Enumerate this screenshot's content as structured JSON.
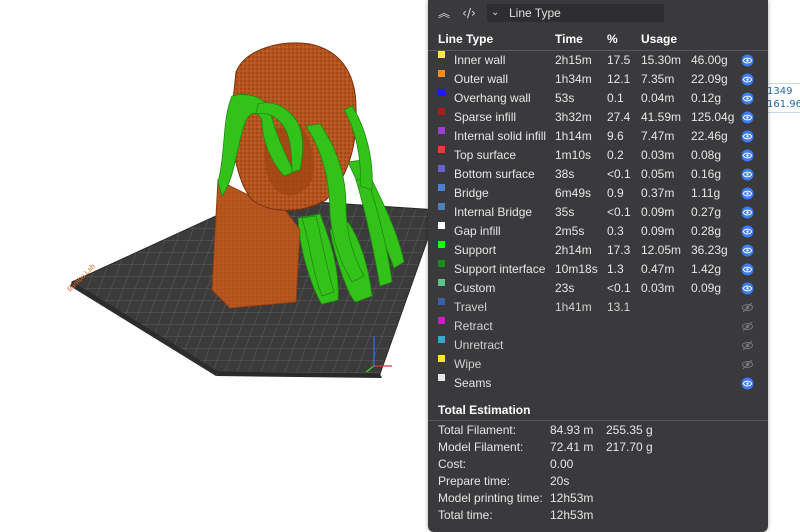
{
  "viewport": {
    "plate_label": "Bambu Lab",
    "coord_readout": [
      "1349",
      "161.96"
    ]
  },
  "toolbar": {
    "collapse_icon": "double-chevron-up-icon",
    "code_icon": "code-brackets-icon",
    "view_select": "Line Type"
  },
  "table": {
    "headers": {
      "line_type": "Line Type",
      "time": "Time",
      "percent": "%",
      "usage": "Usage"
    },
    "rows": [
      {
        "name": "Inner wall",
        "color": "#ffe64d",
        "time": "2h15m",
        "percent": "17.5",
        "length": "15.30m",
        "weight": "46.00g",
        "visible": true
      },
      {
        "name": "Outer wall",
        "color": "#ff8c1a",
        "time": "1h34m",
        "percent": "12.1",
        "length": "7.35m",
        "weight": "22.09g",
        "visible": true
      },
      {
        "name": "Overhang wall",
        "color": "#1a1aff",
        "time": "53s",
        "percent": "0.1",
        "length": "0.04m",
        "weight": "0.12g",
        "visible": true
      },
      {
        "name": "Sparse infill",
        "color": "#b01a1a",
        "time": "3h32m",
        "percent": "27.4",
        "length": "41.59m",
        "weight": "125.04g",
        "visible": true
      },
      {
        "name": "Internal solid infill",
        "color": "#9a3fd6",
        "time": "1h14m",
        "percent": "9.6",
        "length": "7.47m",
        "weight": "22.46g",
        "visible": true
      },
      {
        "name": "Top surface",
        "color": "#e63c3c",
        "time": "1m10s",
        "percent": "0.2",
        "length": "0.03m",
        "weight": "0.08g",
        "visible": true
      },
      {
        "name": "Bottom surface",
        "color": "#6b5fd6",
        "time": "38s",
        "percent": "<0.1",
        "length": "0.05m",
        "weight": "0.16g",
        "visible": true
      },
      {
        "name": "Bridge",
        "color": "#4a7fd6",
        "time": "6m49s",
        "percent": "0.9",
        "length": "0.37m",
        "weight": "1.11g",
        "visible": true
      },
      {
        "name": "Internal Bridge",
        "color": "#4d80b3",
        "time": "35s",
        "percent": "<0.1",
        "length": "0.09m",
        "weight": "0.27g",
        "visible": true
      },
      {
        "name": "Gap infill",
        "color": "#ffffff",
        "time": "2m5s",
        "percent": "0.3",
        "length": "0.09m",
        "weight": "0.28g",
        "visible": true
      },
      {
        "name": "Support",
        "color": "#1aff1a",
        "time": "2h14m",
        "percent": "17.3",
        "length": "12.05m",
        "weight": "36.23g",
        "visible": true
      },
      {
        "name": "Support interface",
        "color": "#1a8c1a",
        "time": "10m18s",
        "percent": "1.3",
        "length": "0.47m",
        "weight": "1.42g",
        "visible": true
      },
      {
        "name": "Custom",
        "color": "#5ec48a",
        "time": "23s",
        "percent": "<0.1",
        "length": "0.03m",
        "weight": "0.09g",
        "visible": true
      },
      {
        "name": "Travel",
        "color": "#3a5ea8",
        "time": "1h41m",
        "percent": "13.1",
        "length": "",
        "weight": "",
        "visible": false
      },
      {
        "name": "Retract",
        "color": "#cc1acc",
        "time": "",
        "percent": "",
        "length": "",
        "weight": "",
        "visible": false
      },
      {
        "name": "Unretract",
        "color": "#3aa6cc",
        "time": "",
        "percent": "",
        "length": "",
        "weight": "",
        "visible": false
      },
      {
        "name": "Wipe",
        "color": "#ffe61a",
        "time": "",
        "percent": "",
        "length": "",
        "weight": "",
        "visible": false
      },
      {
        "name": "Seams",
        "color": "#e6e6e6",
        "time": "",
        "percent": "",
        "length": "",
        "weight": "",
        "visible": true
      }
    ]
  },
  "estimation": {
    "title": "Total Estimation",
    "rows": [
      {
        "label": "Total Filament:",
        "v1": "84.93 m",
        "v2": "255.35 g"
      },
      {
        "label": "Model Filament:",
        "v1": "72.41 m",
        "v2": "217.70 g"
      },
      {
        "label": "Cost:",
        "v1": "0.00",
        "v2": ""
      },
      {
        "label": "Prepare time:",
        "v1": "20s",
        "v2": ""
      },
      {
        "label": "Model printing time:",
        "v1": "12h53m",
        "v2": ""
      },
      {
        "label": "Total time:",
        "v1": "12h53m",
        "v2": ""
      }
    ]
  },
  "colors": {
    "panel_bg": "#3a3a3d",
    "eye_on": "#3d7df2",
    "eye_off": "#777777",
    "model_brown": "#b5541c",
    "support_green": "#33c21a",
    "plate_dark": "#3b3b3b"
  }
}
